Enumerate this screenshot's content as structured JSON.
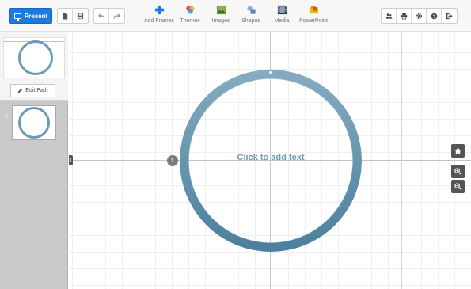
{
  "toolbar": {
    "present_label": "Present",
    "file_buttons": [
      "document-icon",
      "save-icon"
    ],
    "history_buttons": [
      "undo-icon",
      "redo-icon"
    ],
    "insert_items": [
      {
        "label": "Add Frames",
        "icon": "add-frames-icon",
        "color": "#1f7ae0"
      },
      {
        "label": "Themes",
        "icon": "themes-icon",
        "color": "#e0483e"
      },
      {
        "label": "Images",
        "icon": "images-icon",
        "color": "#3f8a2e"
      },
      {
        "label": "Shapes",
        "icon": "shapes-icon",
        "color": "#6a8fc7"
      },
      {
        "label": "Media",
        "icon": "media-icon",
        "color": "#333333"
      },
      {
        "label": "PowerPoint",
        "icon": "powerpoint-icon",
        "color": "#e6b422"
      }
    ],
    "right_buttons": [
      "share-icon",
      "print-icon",
      "settings-icon",
      "help-icon",
      "exit-icon"
    ]
  },
  "sidebar": {
    "edit_path_label": "Edit Path",
    "slides": [
      {
        "number": "1"
      }
    ]
  },
  "canvas": {
    "placeholder_text": "Click to add text",
    "path_number": "1",
    "frame_color": "#6c9bb5",
    "controls": [
      "home-icon",
      "zoom-in-icon",
      "zoom-out-icon"
    ]
  }
}
